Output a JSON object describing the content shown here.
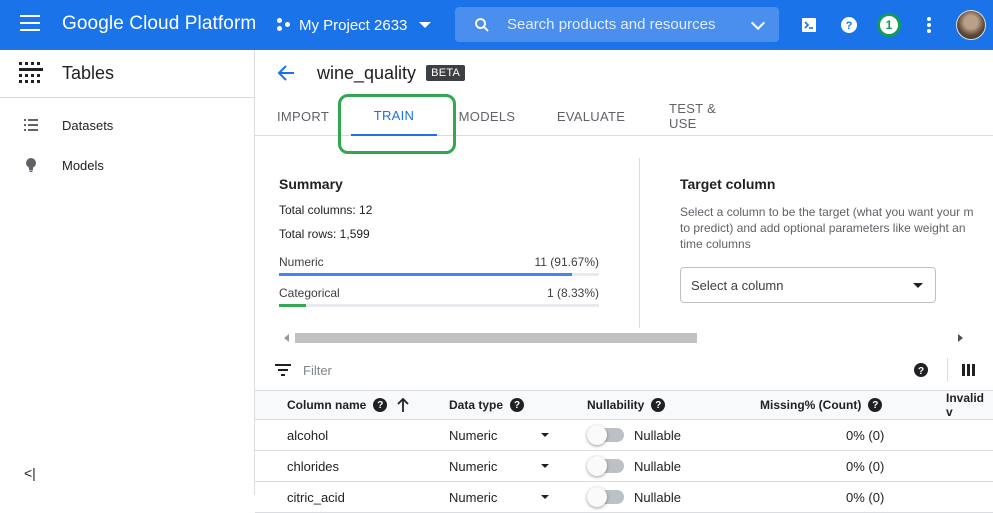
{
  "topbar": {
    "logo": "Google Cloud Platform",
    "project": "My Project 2633",
    "search_placeholder": "Search products and resources",
    "notification_count": "1",
    "colors": {
      "bar": "#1a73e8",
      "badge": "#0f9d58"
    }
  },
  "sidebar": {
    "title": "Tables",
    "items": [
      {
        "label": "Datasets",
        "icon": "list-icon"
      },
      {
        "label": "Models",
        "icon": "lightbulb-icon"
      }
    ],
    "collapse": "<|"
  },
  "header": {
    "dataset_name": "wine_quality",
    "badge": "BETA"
  },
  "tabs": [
    {
      "label": "IMPORT",
      "active": false
    },
    {
      "label": "TRAIN",
      "active": true
    },
    {
      "label": "MODELS",
      "active": false
    },
    {
      "label": "EVALUATE",
      "active": false
    },
    {
      "label": "TEST & USE",
      "active": false
    }
  ],
  "summary": {
    "title": "Summary",
    "total_columns": "Total columns: 12",
    "total_rows": "Total rows: 1,599",
    "breakdown": [
      {
        "label": "Numeric",
        "value": "11 (91.67%)",
        "fraction": 0.9167,
        "color": "#4285f4"
      },
      {
        "label": "Categorical",
        "value": "1 (8.33%)",
        "fraction": 0.0833,
        "color": "#34a853"
      }
    ]
  },
  "target": {
    "title": "Target column",
    "description": "Select a column to be the target (what you want your m to predict) and add optional parameters like weight an time columns",
    "select_placeholder": "Select a column"
  },
  "filter": {
    "placeholder": "Filter"
  },
  "table": {
    "headers": {
      "name": "Column name",
      "type": "Data type",
      "nullability": "Nullability",
      "missing": "Missing% (Count)",
      "invalid": "Invalid v"
    },
    "rows": [
      {
        "name": "alcohol",
        "type": "Numeric",
        "nullability": "Nullable",
        "missing": "0% (0)"
      },
      {
        "name": "chlorides",
        "type": "Numeric",
        "nullability": "Nullable",
        "missing": "0% (0)"
      },
      {
        "name": "citric_acid",
        "type": "Numeric",
        "nullability": "Nullable",
        "missing": "0% (0)"
      }
    ]
  }
}
